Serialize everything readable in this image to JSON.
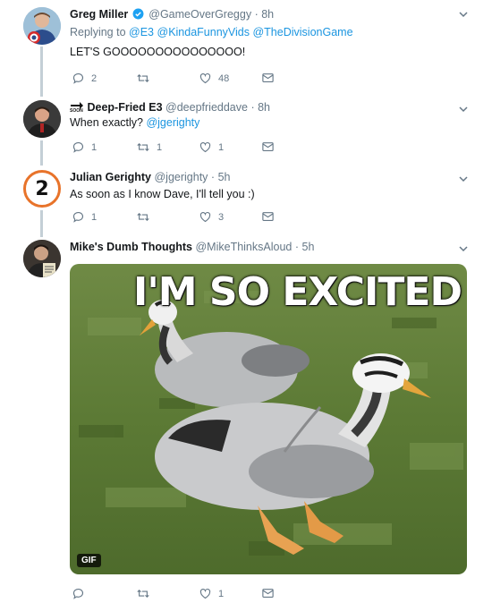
{
  "tweets": [
    {
      "name": "Greg Miller",
      "handle": "@GameOverGreggy",
      "time": "8h",
      "replying_prefix": "Replying to",
      "replying_to": [
        "@E3",
        "@KindaFunnyVids",
        "@TheDivisionGame"
      ],
      "text": "LET'S GOOOOOOOOOOOOOOO!",
      "counts": {
        "reply": "2",
        "retweet": "",
        "like": "48"
      }
    },
    {
      "name_prefix": "SOON",
      "name": "Deep-Fried E3",
      "handle": "@deepfrieddave",
      "time": "8h",
      "text": "When exactly?",
      "mention": "@jgerighty",
      "counts": {
        "reply": "1",
        "retweet": "1",
        "like": "1"
      }
    },
    {
      "name": "Julian Gerighty",
      "handle": "@jgerighty",
      "time": "5h",
      "text": "As soon as I know Dave, I'll tell you :)",
      "avatar_label": "2",
      "counts": {
        "reply": "1",
        "retweet": "",
        "like": "3"
      }
    },
    {
      "name": "Mike's Dumb Thoughts",
      "handle": "@MikeThinksAloud",
      "time": "5h",
      "media_caption": "I'M SO EXCITED",
      "media_badge": "GIF",
      "counts": {
        "reply": "",
        "retweet": "",
        "like": "1"
      }
    }
  ],
  "colors": {
    "link": "#1b95e0",
    "muted": "#657786",
    "thread_line": "#c4cfd6",
    "verified": "#1da1f2",
    "avatar_ring_orange": "#e8732a"
  },
  "icons": [
    "reply-icon",
    "retweet-icon",
    "like-icon",
    "dm-icon",
    "chevron-down-icon",
    "verified-icon"
  ]
}
